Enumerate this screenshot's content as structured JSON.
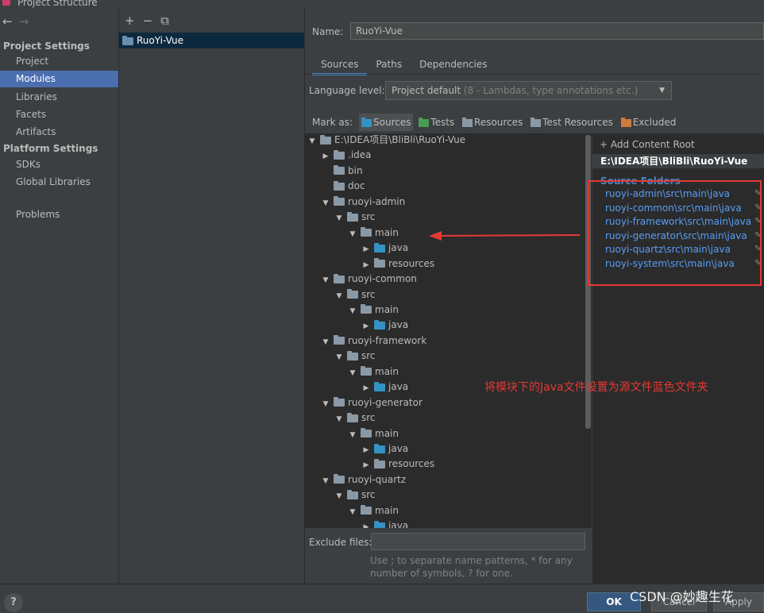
{
  "window": {
    "title": "Project Structure"
  },
  "nav": {
    "back_icon": "arrow-left-icon",
    "forward_icon": "arrow-right-icon",
    "project_settings_header": "Project Settings",
    "project_items": [
      "Project",
      "Modules",
      "Libraries",
      "Facets",
      "Artifacts"
    ],
    "selected": "Modules",
    "platform_settings_header": "Platform Settings",
    "platform_items": [
      "SDKs",
      "Global Libraries"
    ],
    "problems": "Problems"
  },
  "modules": {
    "toolbar": {
      "add": "+",
      "remove": "−",
      "copy_icon": "copy-icon"
    },
    "items": [
      "RuoYi-Vue"
    ]
  },
  "module": {
    "name_label": "Name:",
    "name_value": "RuoYi-Vue",
    "tabs": [
      "Sources",
      "Paths",
      "Dependencies"
    ],
    "active_tab": "Sources",
    "language_level_label": "Language level:",
    "language_level_value": "Project default",
    "language_level_detail": "(8 - Lambdas, type annotations etc.)",
    "mark_as_label": "Mark as:",
    "mark_as": [
      {
        "label": "Sources",
        "color": "#3592c4",
        "selected": true
      },
      {
        "label": "Tests",
        "color": "#499c54",
        "selected": false
      },
      {
        "label": "Resources",
        "color": "#8a99a6",
        "selected": false
      },
      {
        "label": "Test Resources",
        "color": "#8a99a6",
        "selected": false
      },
      {
        "label": "Excluded",
        "color": "#d07b3e",
        "selected": false
      }
    ]
  },
  "tree": [
    {
      "label": "E:\\IDEA项目\\BliBli\\RuoYi-Vue",
      "depth": 0,
      "state": "expanded",
      "color": "gray"
    },
    {
      "label": ".idea",
      "depth": 1,
      "state": "collapsed",
      "color": "gray"
    },
    {
      "label": "bin",
      "depth": 1,
      "state": "leaf",
      "color": "gray"
    },
    {
      "label": "doc",
      "depth": 1,
      "state": "leaf",
      "color": "gray"
    },
    {
      "label": "ruoyi-admin",
      "depth": 1,
      "state": "expanded",
      "color": "gray"
    },
    {
      "label": "src",
      "depth": 2,
      "state": "expanded",
      "color": "gray"
    },
    {
      "label": "main",
      "depth": 3,
      "state": "expanded",
      "color": "gray"
    },
    {
      "label": "java",
      "depth": 4,
      "state": "collapsed",
      "color": "blue"
    },
    {
      "label": "resources",
      "depth": 4,
      "state": "collapsed",
      "color": "gray"
    },
    {
      "label": "ruoyi-common",
      "depth": 1,
      "state": "expanded",
      "color": "gray"
    },
    {
      "label": "src",
      "depth": 2,
      "state": "expanded",
      "color": "gray"
    },
    {
      "label": "main",
      "depth": 3,
      "state": "expanded",
      "color": "gray"
    },
    {
      "label": "java",
      "depth": 4,
      "state": "collapsed",
      "color": "blue"
    },
    {
      "label": "ruoyi-framework",
      "depth": 1,
      "state": "expanded",
      "color": "gray"
    },
    {
      "label": "src",
      "depth": 2,
      "state": "expanded",
      "color": "gray"
    },
    {
      "label": "main",
      "depth": 3,
      "state": "expanded",
      "color": "gray"
    },
    {
      "label": "java",
      "depth": 4,
      "state": "collapsed",
      "color": "blue"
    },
    {
      "label": "ruoyi-generator",
      "depth": 1,
      "state": "expanded",
      "color": "gray"
    },
    {
      "label": "src",
      "depth": 2,
      "state": "expanded",
      "color": "gray"
    },
    {
      "label": "main",
      "depth": 3,
      "state": "expanded",
      "color": "gray"
    },
    {
      "label": "java",
      "depth": 4,
      "state": "collapsed",
      "color": "blue"
    },
    {
      "label": "resources",
      "depth": 4,
      "state": "collapsed",
      "color": "gray"
    },
    {
      "label": "ruoyi-quartz",
      "depth": 1,
      "state": "expanded",
      "color": "gray"
    },
    {
      "label": "src",
      "depth": 2,
      "state": "expanded",
      "color": "gray"
    },
    {
      "label": "main",
      "depth": 3,
      "state": "expanded",
      "color": "gray"
    },
    {
      "label": "java",
      "depth": 4,
      "state": "collapsed",
      "color": "blue"
    }
  ],
  "content_root": {
    "add_label": "+ Add Content Root",
    "path": "E:\\IDEA项目\\BliBli\\RuoYi-Vue",
    "source_folders_header": "Source Folders",
    "source_folders": [
      "ruoyi-admin\\src\\main\\java",
      "ruoyi-common\\src\\main\\java",
      "ruoyi-framework\\src\\main\\java",
      "ruoyi-generator\\src\\main\\java",
      "ruoyi-quartz\\src\\main\\java",
      "ruoyi-system\\src\\main\\java"
    ]
  },
  "annotation": {
    "text": "将模块下的Java文件设置为源文件蓝色文件夹",
    "color": "#e53935"
  },
  "exclude": {
    "label": "Exclude files:",
    "value": "",
    "hint": "Use ; to separate name patterns, * for any number of symbols, ? for one."
  },
  "footer": {
    "help": "?",
    "ok": "OK",
    "cancel": "Cancel",
    "apply": "Apply"
  },
  "watermark": "CSDN @妙趣生花"
}
